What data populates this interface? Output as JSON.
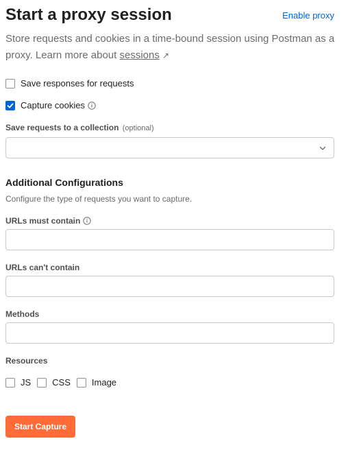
{
  "header": {
    "title": "Start a proxy session",
    "enable_link": "Enable proxy"
  },
  "description": {
    "text": "Store requests and cookies in a time-bound session using Postman as a proxy. Learn more about ",
    "link": "sessions",
    "arrow": "↗"
  },
  "options": {
    "save_responses": {
      "label": "Save responses for requests",
      "checked": false
    },
    "capture_cookies": {
      "label": "Capture cookies",
      "checked": true
    }
  },
  "collection": {
    "label": "Save requests to a collection",
    "optional": "(optional)",
    "value": ""
  },
  "additional": {
    "title": "Additional Configurations",
    "description": "Configure the type of requests you want to capture."
  },
  "fields": {
    "urls_must_contain": {
      "label": "URLs must contain",
      "value": ""
    },
    "urls_cant_contain": {
      "label": "URLs can't contain",
      "value": ""
    },
    "methods": {
      "label": "Methods",
      "value": ""
    }
  },
  "resources": {
    "label": "Resources",
    "items": [
      {
        "label": "JS",
        "checked": false
      },
      {
        "label": "CSS",
        "checked": false
      },
      {
        "label": "Image",
        "checked": false
      }
    ]
  },
  "actions": {
    "start_label": "Start Capture"
  },
  "colors": {
    "accent": "#ff6c37",
    "link": "#0265d2",
    "checkbox_checked": "#0265d2"
  }
}
